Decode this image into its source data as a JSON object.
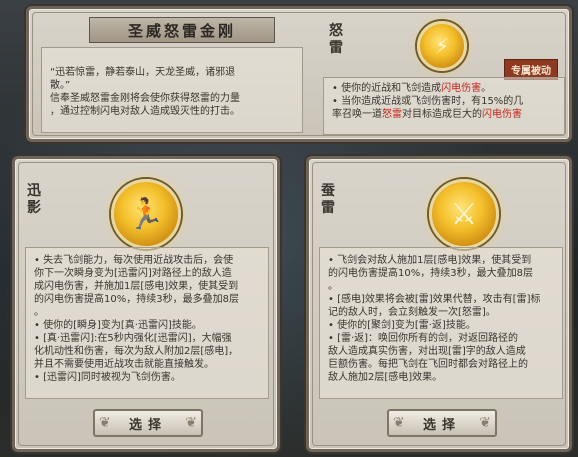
{
  "top": {
    "title": "圣威怒雷金刚",
    "vertical_label": "怒雷",
    "tag": "专属被动",
    "quote_lines": [
      "“迅若惊雷，静若泰山，天龙圣威，诸邪退",
      "散。”",
      "信奉圣威怒雷金刚将会使你获得怒雷的力量",
      "，通过控制闪电对敌人造成毁灭性的打击。"
    ],
    "effects": [
      {
        "prefix": "• ",
        "a": "使你的近战和飞剑造成",
        "b": "闪电伤害",
        "c": "。"
      },
      {
        "prefix": "• ",
        "a": "当你造成近战或飞剑伤害时，有15%的几",
        "b": "",
        "c": ""
      },
      {
        "prefix": "  ",
        "a": "率召唤一道",
        "b": "怒雷",
        "c": "对目标造成巨大的",
        "d": "闪电伤害"
      }
    ]
  },
  "left_card": {
    "vertical_label": "迅影",
    "emblem_icon": "runner-silhouette-icon",
    "lines": [
      "• 失去飞剑能力，每次使用近战攻击后，会使",
      "你下一次瞬身变为[迅雷闪]对路径上的敌人造",
      "成闪电伤害，并施加1层[感电]效果，使其受到",
      "的闪电伤害提高10%，持续3秒，最多叠加8层",
      "。",
      "• 使你的[瞬身]变为[真·迅雷闪]技能。",
      "• [真·迅雷闪]:在5秒内强化[迅雷闪]，大幅强",
      "化机动性和伤害，每次为敌人附加2层[感电]，",
      "并且不需要使用近战攻击就能直接触发。",
      "• [迅雷闪]同时被视为飞剑伤害。"
    ],
    "button": "选择"
  },
  "right_card": {
    "vertical_label": "蚕雷",
    "emblem_icon": "lightning-sword-icon",
    "lines": [
      "• 飞剑会对敌人施加1层[感电]效果，使其受到",
      "的闪电伤害提高10%，持续3秒，最大叠加8层",
      "。",
      "• [感电]效果将会被[雷]效果代替，攻击有[雷]标",
      "记的敌人时，会立刻触发一次[怒雷]。",
      "• 使你的[聚剑]变为[雷·返]技能。",
      "• [雷·返]：唤回你所有的剑，对返回路径的",
      "敌人造成真实伤害，对出现[雷]字的敌人造成",
      "巨额伤害。每把飞剑在飞回时都会对路径上的",
      "敌人施加2层[感电]效果。"
    ],
    "button": "选择"
  },
  "colors": {
    "red": "#c0281c",
    "blue": "#1f4fa8",
    "gold": "#f4c02c",
    "tag_bg": "#8e3a22"
  }
}
